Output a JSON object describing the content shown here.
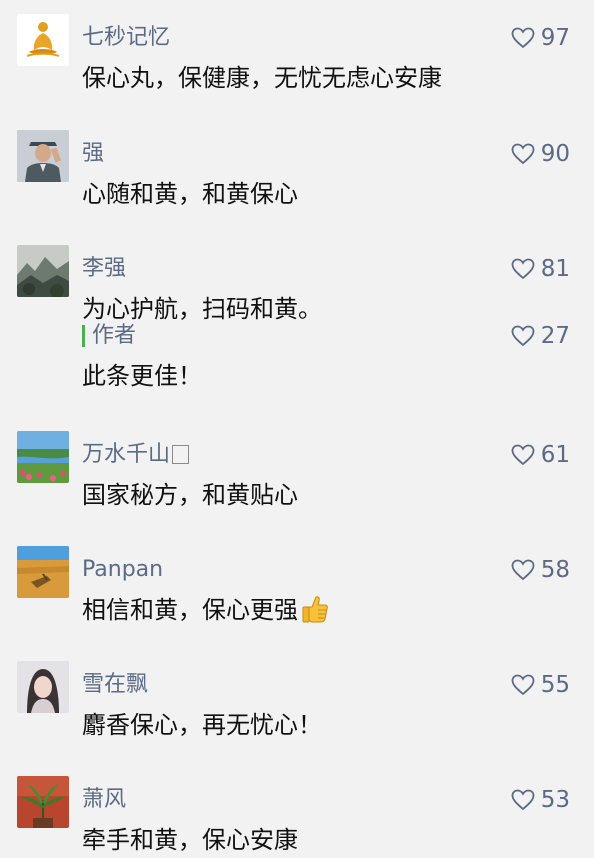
{
  "comments": [
    {
      "name": "七秒记忆",
      "text": "保心丸，保健康，无忧无虑心安康",
      "likes": "97",
      "avatar": "lotus-logo-avatar"
    },
    {
      "name": "强",
      "text": "心随和黄，和黄保心",
      "likes": "90",
      "avatar": "soldier-photo-avatar"
    },
    {
      "name": "李强",
      "text": "为心护航，扫码和黄。",
      "likes": "81",
      "avatar": "mountain-photo-avatar",
      "author_reply": {
        "tag": "作者",
        "text": "此条更佳！",
        "likes": "27"
      }
    },
    {
      "name": "万水千山",
      "text": "国家秘方，和黄贴心",
      "likes": "61",
      "avatar": "landscape-photo-avatar"
    },
    {
      "name": "Panpan",
      "text": "相信和黄，保心更强",
      "likes": "58",
      "avatar": "field-photo-avatar",
      "emoji": "thumbs-up-emoji"
    },
    {
      "name": "雪在飘",
      "text": "麝香保心，再无忧心！",
      "likes": "55",
      "avatar": "portrait-photo-avatar"
    },
    {
      "name": "萧风",
      "text": "牵手和黄，保心安康",
      "likes": "53",
      "avatar": "plant-photo-avatar"
    }
  ],
  "colors": {
    "background": "#f2f2f2",
    "name": "#5c6a86",
    "text": "#111111",
    "author_bar": "#4caf50"
  }
}
